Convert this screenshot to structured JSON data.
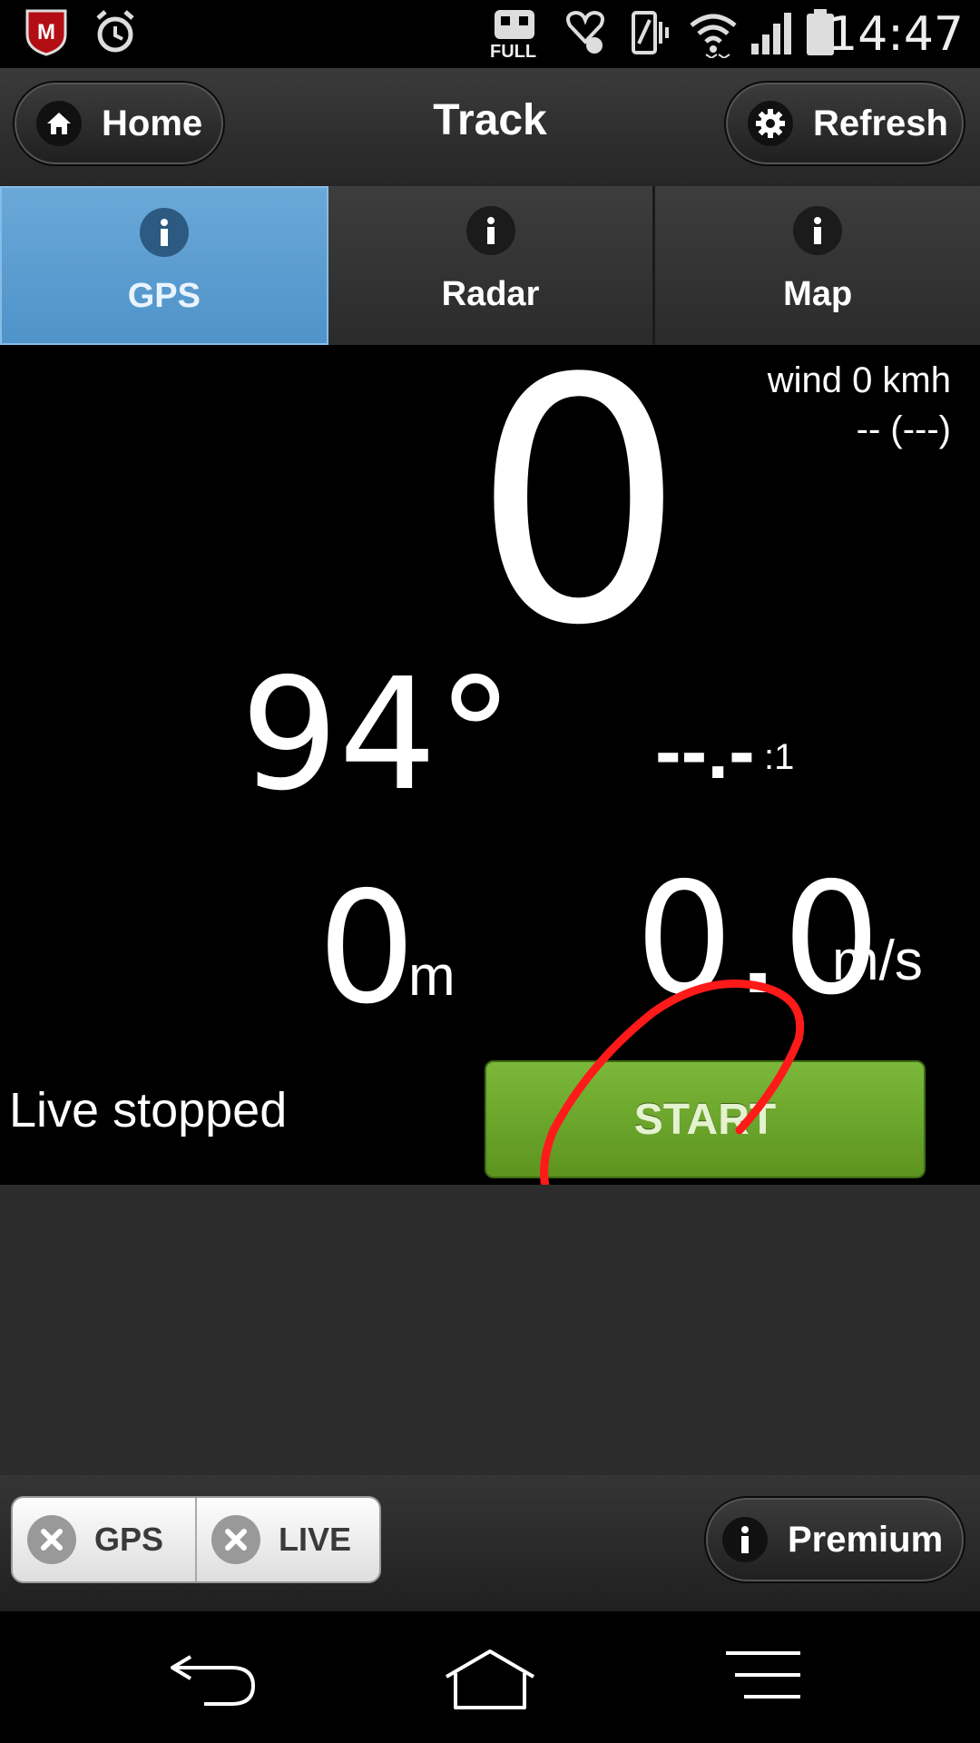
{
  "status_bar": {
    "time": "14:47",
    "full_badge": "FULL",
    "icons": [
      "mcafee-icon",
      "alarm-icon",
      "full-icon",
      "health-icon",
      "vibrate-icon",
      "wifi-icon",
      "signal-icon",
      "battery-icon"
    ]
  },
  "header": {
    "title": "Track",
    "home_label": "Home",
    "refresh_label": "Refresh"
  },
  "tabs": [
    {
      "label": "GPS",
      "active": true
    },
    {
      "label": "Radar",
      "active": false
    },
    {
      "label": "Map",
      "active": false
    }
  ],
  "readings": {
    "speed": "0",
    "wind_line1": "wind 0 kmh",
    "wind_line2": "-- (---)",
    "heading": "94°",
    "glide_ratio": "--.-",
    "glide_suffix": ":1",
    "altitude": "0",
    "altitude_unit": "m",
    "vertical_speed": "0.0",
    "vertical_speed_unit": "m/s"
  },
  "live": {
    "status": "Live stopped",
    "start_label": "START"
  },
  "bottom_bar": {
    "gps_label": "GPS",
    "live_label": "LIVE",
    "premium_label": "Premium"
  },
  "colors": {
    "active_tab": "#5a9dd0",
    "start_button": "#6aa52a",
    "annotation": "#ff1a1a"
  }
}
